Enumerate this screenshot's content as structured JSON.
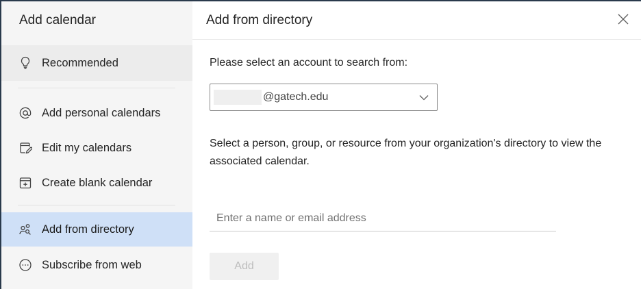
{
  "sidebar": {
    "title": "Add calendar",
    "items": [
      {
        "label": "Recommended",
        "icon": "lightbulb-icon"
      },
      {
        "label": "Add personal calendars",
        "icon": "at-sign-icon"
      },
      {
        "label": "Edit my calendars",
        "icon": "edit-calendar-icon"
      },
      {
        "label": "Create blank calendar",
        "icon": "calendar-add-icon"
      },
      {
        "label": "Add from directory",
        "icon": "people-search-icon"
      },
      {
        "label": "Subscribe from web",
        "icon": "more-circle-icon"
      }
    ],
    "selected_index": 4
  },
  "main": {
    "title": "Add from directory",
    "close_icon": "close-icon",
    "account_prompt": "Please select an account to search from:",
    "account_value": "@gatech.edu",
    "dropdown_icon": "chevron-down-icon",
    "description": "Select a person, group, or resource from your organization's directory to view the associated calendar.",
    "search_placeholder": "Enter a name or email address",
    "add_label": "Add"
  },
  "colors": {
    "sidebar_bg": "#f5f5f5",
    "selected_bg": "#cfe0f7",
    "disabled_text": "#bdbdbd"
  }
}
